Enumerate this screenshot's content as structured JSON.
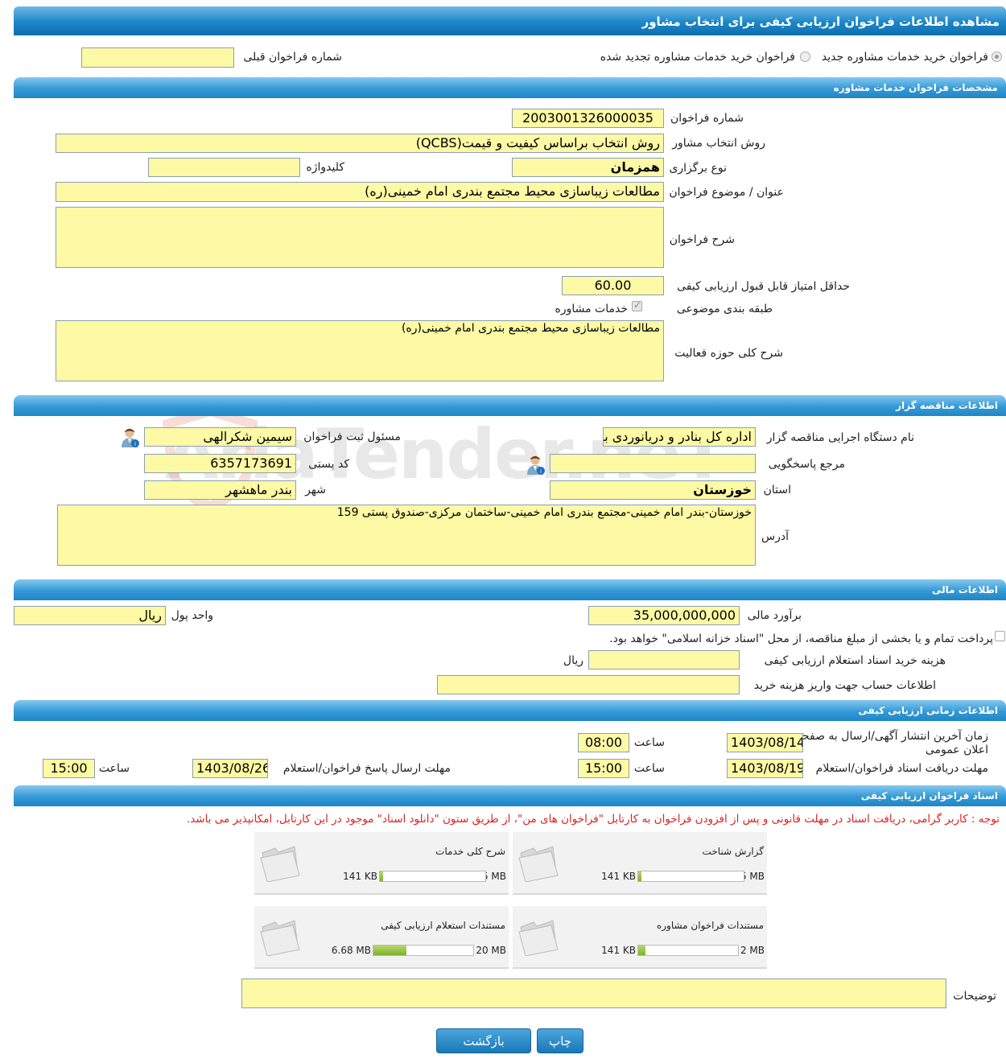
{
  "page": {
    "title": "مشاهده اطلاعات فراخوان ارزیابی کیفی برای انتخاب مشاور"
  },
  "top": {
    "radio_new": "فراخوان خرید خدمات مشاوره جدید",
    "radio_renewed": "فراخوان خرید خدمات مشاوره تجدید شده",
    "prev_label": "شماره فراخوان قبلی",
    "prev_value": ""
  },
  "sections": {
    "consult": "مشخصات فراخوان خدمات مشاوره",
    "tenderer": "اطلاعات مناقصه گزار",
    "financial": "اطلاعات مالی",
    "timing": "اطلاعات زمانی ارزیابی کیفی",
    "docs": "اسناد فراخوان ارزیابی کیفی"
  },
  "consult": {
    "number_label": "شماره فراخوان",
    "number": "2003001326000035",
    "method_label": "روش انتخاب مشاور",
    "method": "روش انتخاب براساس کیفیت و قیمت(QCBS)",
    "type_label": "نوع برگزاری",
    "type": "همزمان",
    "keyword_label": "کلیدواژه",
    "keyword": "",
    "subject_label": "عنوان / موضوع فراخوان",
    "subject": "مطالعات زیباسازی محیط مجتمع بندری امام خمینی(ره)",
    "desc_label": "شرح فراخوان",
    "desc": "",
    "min_score_label": "حداقل امتیاز قابل قبول ارزیابی کیفی",
    "min_score": "60.00",
    "category_label": "طبقه بندی موضوعی",
    "category_item": "خدمات مشاوره",
    "scope_label": "شرح کلی حوزه فعالیت",
    "scope": "مطالعات زیباسازی محیط مجتمع بندری امام خمینی(ره)"
  },
  "tenderer": {
    "org_label": "نام دستگاه اجرایی مناقصه گزار",
    "org": "اداره کل بنادر و دریانوردی بن",
    "registrar_label": "مسئول ثبت فراخوان",
    "registrar": "سیمین شکرالهی",
    "ref_label": "مرجع پاسخگویی",
    "ref": "",
    "postal_label": "کد پستی",
    "postal": "6357173691",
    "province_label": "استان",
    "province": "خوزستان",
    "city_label": "شهر",
    "city": "بندر ماهشهر",
    "address_label": "آدرس",
    "address": "خوزستان-بندر امام خمینی-مجتمع بندری امام خمینی-ساختمان مرکزی-صندوق پستی 159"
  },
  "financial": {
    "estimate_label": "برآورد مالی",
    "estimate": "35,000,000,000",
    "currency_label": "واحد پول",
    "currency": "ریال",
    "treasury_text": "پرداخت تمام و یا بخشی از مبلغ مناقصه، از محل \"اسناد خزانه اسلامی\" خواهد بود.",
    "doc_fee_label": "هزینه خرید اسناد استعلام ارزیابی کیفی",
    "doc_fee": "",
    "doc_fee_unit": "ریال",
    "account_label": "اطلاعات حساب جهت واریز هزینه خرید",
    "account": ""
  },
  "timing": {
    "publish_label": "زمان آخرین انتشار آگهی/ارسال به صفحه اعلان عمومی",
    "publish_date": "1403/08/14",
    "hour_label": "ساعت",
    "publish_time": "08:00",
    "receive_label": "مهلت دریافت اسناد فراخوان/استعلام",
    "receive_date": "1403/08/19",
    "receive_time": "15:00",
    "submit_label": "مهلت ارسال پاسخ فراخوان/استعلام",
    "submit_date": "1403/08/26",
    "submit_time": "15:00"
  },
  "docs": {
    "note": "توجه : کاربر گرامی، دریافت اسناد در مهلت قانونی و پس از افزودن فراخوان به کارتابل \"فراخوان های من\"، از طریق ستون \"دانلود اسناد\" موجود در این کارتابل، امکانپذیر می باشد.",
    "files": [
      {
        "name": "گزارش شناخت",
        "size": "141 KB",
        "max": "5 MB",
        "ratio": 0.03
      },
      {
        "name": "شرح کلی خدمات",
        "size": "141 KB",
        "max": "5 MB",
        "ratio": 0.03
      },
      {
        "name": "مستندات فراخوان مشاوره",
        "size": "141 KB",
        "max": "2 MB",
        "ratio": 0.07
      },
      {
        "name": "مستندات استعلام ارزیابی کیفی",
        "size": "6.68 MB",
        "max": "20 MB",
        "ratio": 0.33
      }
    ],
    "notes_label": "توضیحات",
    "notes": ""
  },
  "buttons": {
    "print": "چاپ",
    "back": "بازگشت"
  },
  "watermark": "AriaTender.neT",
  "colors": {
    "header": "#1b86c8",
    "field": "#fdf9a4",
    "note": "#dd2222",
    "bar": "#8cbd3a"
  }
}
